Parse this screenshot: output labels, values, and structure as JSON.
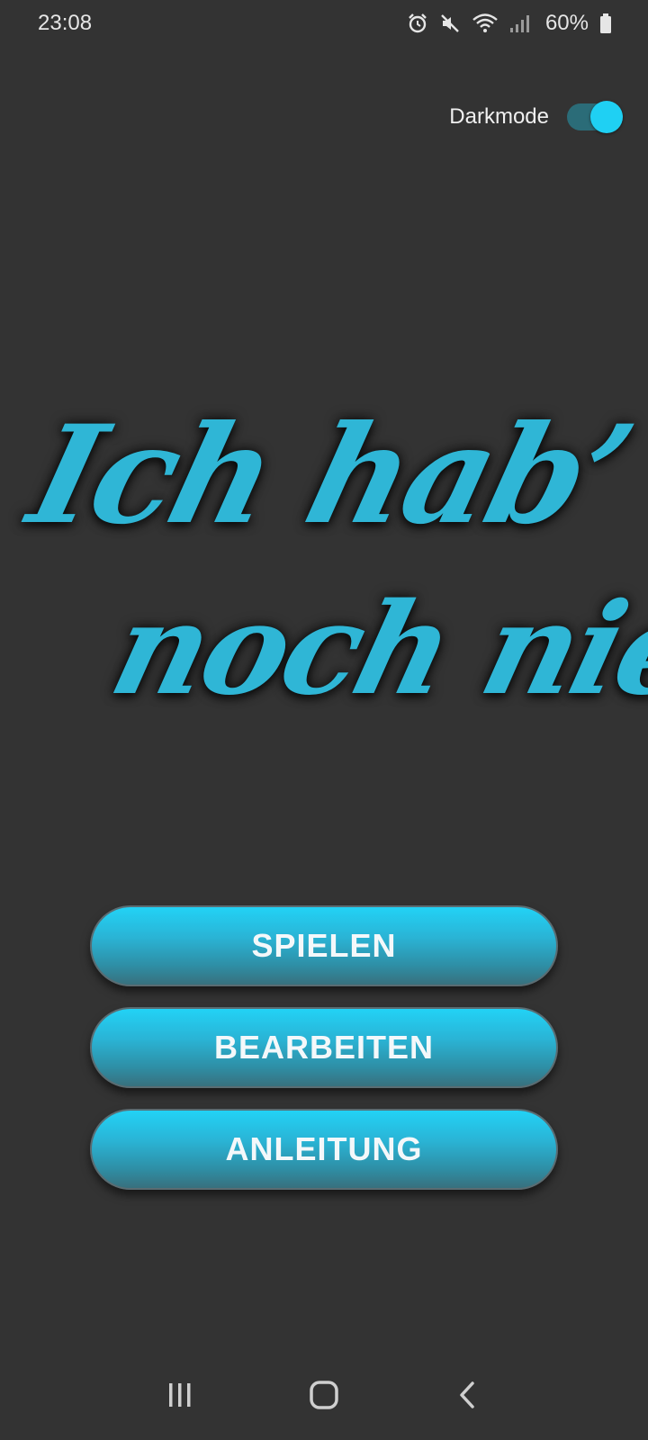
{
  "status_bar": {
    "time": "23:08",
    "battery": "60%",
    "icons": [
      "alarm-icon",
      "mute-icon",
      "wifi-icon",
      "signal-icon",
      "battery-icon"
    ]
  },
  "darkmode": {
    "label": "Darkmode",
    "enabled": true
  },
  "logo": {
    "line1": "Ich hab’",
    "line2": "noch nie..."
  },
  "menu": {
    "play_label": "SPIELEN",
    "edit_label": "BEARBEITEN",
    "guide_label": "ANLEITUNG"
  },
  "colors": {
    "background": "#333333",
    "accent": "#1fd0f3",
    "logo": "#2fb6d6"
  },
  "nav_bar": {
    "icons": [
      "recents-icon",
      "home-icon",
      "back-icon"
    ]
  }
}
